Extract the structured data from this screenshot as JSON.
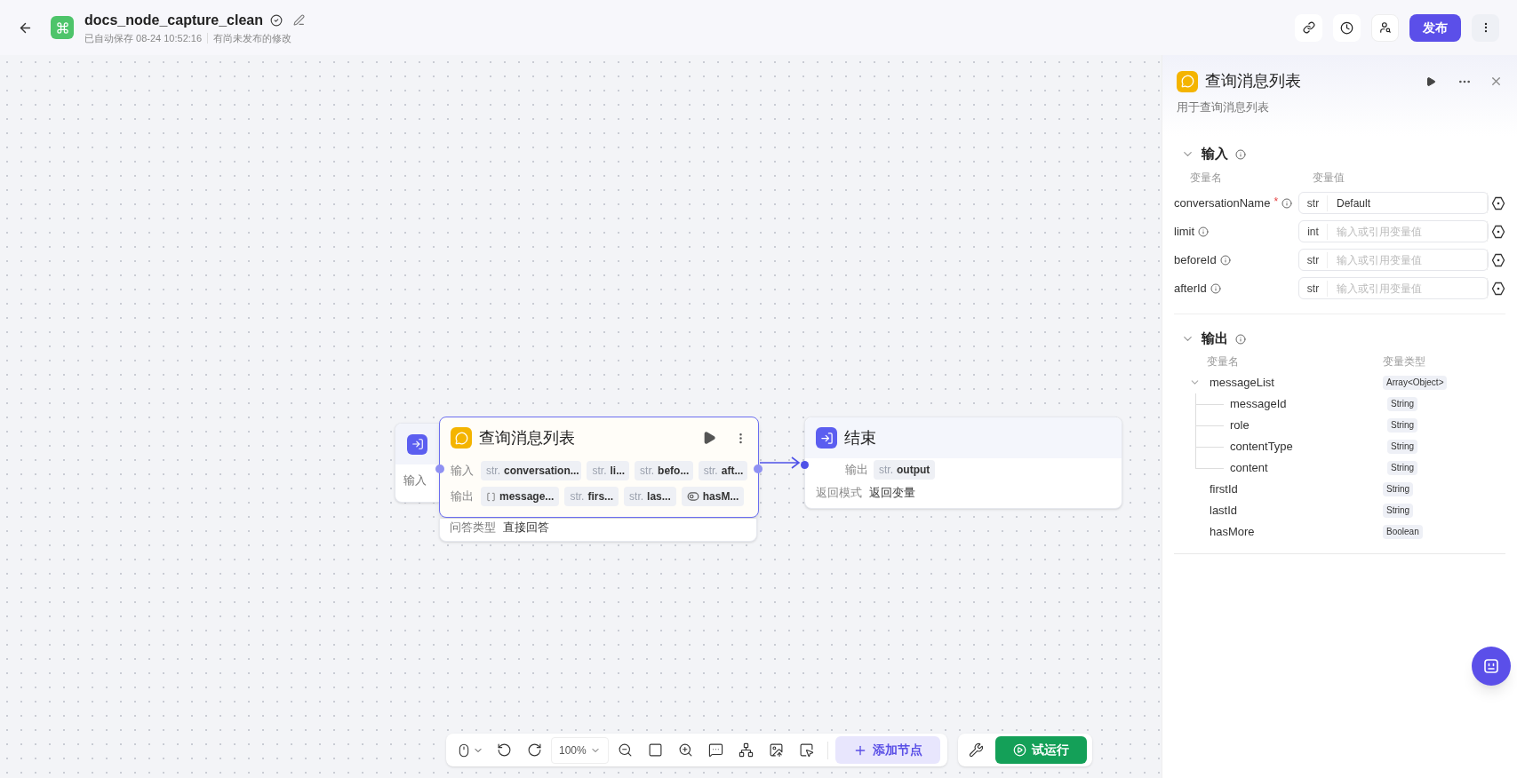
{
  "header": {
    "title": "docs_node_capture_clean",
    "saved": "已自动保存 08-24 10:52:16",
    "unpublished": "有尚未发布的修改",
    "publish_button": "发布"
  },
  "canvas": {
    "nodes": [
      {
        "kind": "start",
        "selected": false,
        "rows": [
          {
            "label": "输入"
          }
        ]
      },
      {
        "kind": "query",
        "selected": true,
        "title": "查询消息列表",
        "inputs_label": "输入",
        "outputs_label": "输出",
        "inputs": [
          {
            "kind": "str",
            "type": "str.",
            "name": "conversation..."
          },
          {
            "kind": "str",
            "type": "str.",
            "name": "li..."
          },
          {
            "kind": "str",
            "type": "str.",
            "name": "befo..."
          },
          {
            "kind": "str",
            "type": "str.",
            "name": "aft..."
          }
        ],
        "outputs": [
          {
            "kind": "array",
            "name": "message..."
          },
          {
            "kind": "str",
            "type": "str.",
            "name": "firs..."
          },
          {
            "kind": "str",
            "type": "str.",
            "name": "las..."
          },
          {
            "kind": "boolean",
            "name": "hasM..."
          }
        ]
      },
      {
        "kind": "answer",
        "selected": false,
        "rows": [
          {
            "label": "问答类型",
            "value": "直接回答"
          }
        ]
      },
      {
        "kind": "end",
        "selected": false,
        "title": "结束",
        "output_label": "输出",
        "output": {
          "type": "str.",
          "name": "output"
        },
        "rows": [
          {
            "label": "返回模式",
            "value": "返回变量"
          }
        ]
      }
    ],
    "toolbar": {
      "zoom": "100%",
      "add_node": "添加节点",
      "test_run": "试运行"
    }
  },
  "panel": {
    "title": "查询消息列表",
    "description": "用于查询消息列表",
    "inputs": {
      "title": "输入",
      "expanded": true,
      "name_header": "变量名",
      "value_header": "变量值",
      "rows": [
        {
          "name": "conversationName",
          "required_mark": "*",
          "type": "str",
          "value": "Default"
        },
        {
          "name": "limit",
          "type": "int",
          "placeholder": "输入或引用变量值"
        },
        {
          "name": "beforeId",
          "type": "str",
          "placeholder": "输入或引用变量值"
        },
        {
          "name": "afterId",
          "type": "str",
          "placeholder": "输入或引用变量值"
        }
      ]
    },
    "outputs": {
      "title": "输出",
      "expanded": true,
      "name_header": "变量名",
      "type_header": "变量类型",
      "rows": [
        {
          "name": "messageList",
          "type": "Array<Object>",
          "expanded": true,
          "children": [
            {
              "name": "messageId",
              "type": "String"
            },
            {
              "name": "role",
              "type": "String"
            },
            {
              "name": "contentType",
              "type": "String"
            },
            {
              "name": "content",
              "type": "String"
            }
          ]
        },
        {
          "name": "firstId",
          "type": "String"
        },
        {
          "name": "lastId",
          "type": "String"
        },
        {
          "name": "hasMore",
          "type": "Boolean"
        }
      ]
    }
  }
}
